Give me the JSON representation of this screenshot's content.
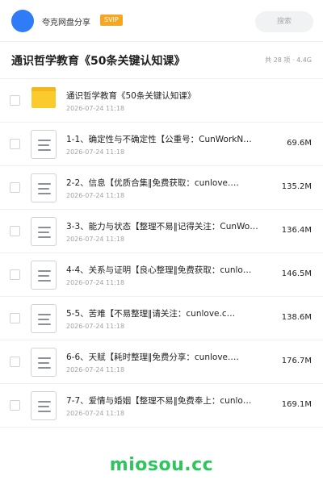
{
  "header": {
    "username": "夸克网盘分享",
    "badge": "SVIP",
    "search_placeholder": "搜索",
    "colors": {
      "avatar": "#2f7cf6",
      "badge": "#f5a623"
    }
  },
  "title_row": {
    "title": "通识哲学教育《50条关键认知课》",
    "summary": "共 28 项 · 4.4G"
  },
  "files": [
    {
      "icon": "folder-icon",
      "name": "通识哲学教育《50条关键认知课》",
      "date": "2026-07-24 11:18",
      "size": ""
    },
    {
      "icon": "document-icon",
      "name": "1-1、确定性与不确定性【公重号：CunWorkN…",
      "date": "2026-07-24 11:18",
      "size": "69.6M"
    },
    {
      "icon": "document-icon",
      "name": "2-2、信息【优质合集‖免费获取：cunlove.…",
      "date": "2026-07-24 11:18",
      "size": "135.2M"
    },
    {
      "icon": "document-icon",
      "name": "3-3、能力与状态【整理不易‖记得关注：CunWo…",
      "date": "2026-07-24 11:18",
      "size": "136.4M"
    },
    {
      "icon": "document-icon",
      "name": "4-4、关系与证明【良心整理‖免费获取：cunlo…",
      "date": "2026-07-24 11:18",
      "size": "146.5M"
    },
    {
      "icon": "document-icon",
      "name": "5-5、苦难【不易整理‖请关注：cunlove.c…",
      "date": "2026-07-24 11:18",
      "size": "138.6M"
    },
    {
      "icon": "document-icon",
      "name": "6-6、天赋【耗时整理‖免费分享：cunlove.…",
      "date": "2026-07-24 11:18",
      "size": "176.7M"
    },
    {
      "icon": "document-icon",
      "name": "7-7、爱情与婚姻【整理不易‖免费奉上：cunlo…",
      "date": "2026-07-24 11:18",
      "size": "169.1M"
    }
  ],
  "watermark": "miosou.cc",
  "watermark_color": "#2fc55d"
}
